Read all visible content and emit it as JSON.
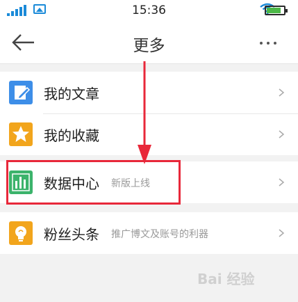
{
  "status_bar": {
    "time": "15:36"
  },
  "header": {
    "title": "更多"
  },
  "menu": {
    "items": [
      {
        "label": "我的文章",
        "subtitle": "",
        "icon": "edit-note-icon",
        "icon_color": "#3d8ee8"
      },
      {
        "label": "我的收藏",
        "subtitle": "",
        "icon": "star-icon",
        "icon_color": "#f2a51c"
      },
      {
        "label": "数据中心",
        "subtitle": "新版上线",
        "icon": "bar-chart-icon",
        "icon_color": "#3bb36b"
      },
      {
        "label": "粉丝头条",
        "subtitle": "推广博文及账号的利器",
        "icon": "bulb-icon",
        "icon_color": "#f2a51c"
      }
    ]
  },
  "annotation": {
    "highlight_color": "#e8283a"
  },
  "watermark": {
    "text": "Bai 经验"
  }
}
